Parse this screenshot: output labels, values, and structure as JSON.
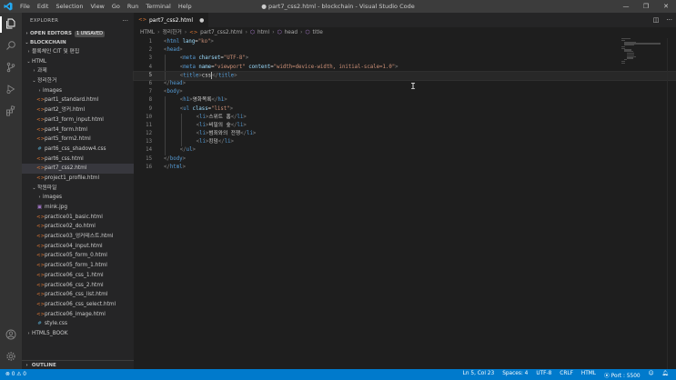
{
  "titlebar": {
    "menu": [
      "File",
      "Edit",
      "Selection",
      "View",
      "Go",
      "Run",
      "Terminal",
      "Help"
    ],
    "title": "● part7_css2.html - blockchain - Visual Studio Code"
  },
  "sidebar": {
    "header": "EXPLORER",
    "open_editors": "OPEN EDITORS",
    "unsaved_badge": "1 UNSAVED",
    "workspace": "BLOCKCHAIN",
    "items": [
      {
        "label": "블록체인 CIT 및 편집",
        "indent": 0,
        "kind": "folder-closed"
      },
      {
        "label": "HTML",
        "indent": 0,
        "kind": "folder-open"
      },
      {
        "label": "과제",
        "indent": 1,
        "kind": "folder-closed"
      },
      {
        "label": "정리한거",
        "indent": 1,
        "kind": "folder-open"
      },
      {
        "label": "images",
        "indent": 2,
        "kind": "folder-closed"
      },
      {
        "label": "part1_standard.html",
        "indent": 2,
        "kind": "html"
      },
      {
        "label": "part2_엉커.html",
        "indent": 2,
        "kind": "html"
      },
      {
        "label": "part3_form_input.html",
        "indent": 2,
        "kind": "html"
      },
      {
        "label": "part4_form.html",
        "indent": 2,
        "kind": "html"
      },
      {
        "label": "part5_form2.html",
        "indent": 2,
        "kind": "html"
      },
      {
        "label": "part6_css_shadow4.css",
        "indent": 2,
        "kind": "css"
      },
      {
        "label": "part6_css.html",
        "indent": 2,
        "kind": "html"
      },
      {
        "label": "part7_css2.html",
        "indent": 2,
        "kind": "html",
        "selected": true
      },
      {
        "label": "project1_profile.html",
        "indent": 2,
        "kind": "html"
      },
      {
        "label": "학원파일",
        "indent": 1,
        "kind": "folder-open"
      },
      {
        "label": "images",
        "indent": 2,
        "kind": "folder-closed"
      },
      {
        "label": "mink.jpg",
        "indent": 2,
        "kind": "jpg"
      },
      {
        "label": "practice01_basic.html",
        "indent": 2,
        "kind": "html"
      },
      {
        "label": "practice02_do.html",
        "indent": 2,
        "kind": "html"
      },
      {
        "label": "practice03_엉커테스트.html",
        "indent": 2,
        "kind": "html"
      },
      {
        "label": "practice04_input.html",
        "indent": 2,
        "kind": "html"
      },
      {
        "label": "practice05_form_0.html",
        "indent": 2,
        "kind": "html"
      },
      {
        "label": "practice05_form_1.html",
        "indent": 2,
        "kind": "html"
      },
      {
        "label": "practice06_css_1.html",
        "indent": 2,
        "kind": "html"
      },
      {
        "label": "practice06_css_2.html",
        "indent": 2,
        "kind": "html"
      },
      {
        "label": "practice06_css_list.html",
        "indent": 2,
        "kind": "html"
      },
      {
        "label": "practice06_css_select.html",
        "indent": 2,
        "kind": "html"
      },
      {
        "label": "practice06_image.html",
        "indent": 2,
        "kind": "html"
      },
      {
        "label": "style.css",
        "indent": 2,
        "kind": "css"
      },
      {
        "label": "HTML5_BOOK",
        "indent": 0,
        "kind": "folder-closed"
      }
    ],
    "outline": "OUTLINE"
  },
  "editor": {
    "tab_label": "part7_css2.html",
    "breadcrumbs": [
      "HTML",
      "정리한거",
      "part7_css2.html",
      "html",
      "head",
      "title"
    ],
    "current_line": 5,
    "lines": [
      {
        "n": "1",
        "indent": 0,
        "tokens": [
          [
            "b",
            "<"
          ],
          [
            "tag",
            "html"
          ],
          [
            "txt",
            " "
          ],
          [
            "attr",
            "lang"
          ],
          [
            "txt",
            "="
          ],
          [
            "str",
            "\"ko\""
          ],
          [
            "b",
            ">"
          ]
        ]
      },
      {
        "n": "2",
        "indent": 0,
        "tokens": [
          [
            "b",
            "<"
          ],
          [
            "tag",
            "head"
          ],
          [
            "b",
            ">"
          ]
        ]
      },
      {
        "n": "3",
        "indent": 2,
        "tokens": [
          [
            "b",
            "<"
          ],
          [
            "tag",
            "meta"
          ],
          [
            "txt",
            " "
          ],
          [
            "attr",
            "charset"
          ],
          [
            "txt",
            "="
          ],
          [
            "str",
            "\"UTF-8\""
          ],
          [
            "b",
            ">"
          ]
        ]
      },
      {
        "n": "4",
        "indent": 2,
        "tokens": [
          [
            "b",
            "<"
          ],
          [
            "tag",
            "meta"
          ],
          [
            "txt",
            " "
          ],
          [
            "attr",
            "name"
          ],
          [
            "txt",
            "="
          ],
          [
            "str",
            "\"viewport\""
          ],
          [
            "txt",
            " "
          ],
          [
            "attr",
            "content"
          ],
          [
            "txt",
            "="
          ],
          [
            "str",
            "\"width=device-width, initial-scale=1.0\""
          ],
          [
            "b",
            ">"
          ]
        ]
      },
      {
        "n": "5",
        "indent": 2,
        "tokens": [
          [
            "b",
            "<"
          ],
          [
            "tag",
            "title"
          ],
          [
            "b",
            ">"
          ],
          [
            "txt",
            "css"
          ],
          [
            "cursor",
            ""
          ],
          [
            "b",
            "</"
          ],
          [
            "tag",
            "title"
          ],
          [
            "b",
            ">"
          ]
        ]
      },
      {
        "n": "6",
        "indent": 0,
        "tokens": [
          [
            "b",
            "</"
          ],
          [
            "tag",
            "head"
          ],
          [
            "b",
            ">"
          ]
        ]
      },
      {
        "n": "7",
        "indent": 0,
        "tokens": [
          [
            "b",
            "<"
          ],
          [
            "tag",
            "body"
          ],
          [
            "b",
            ">"
          ]
        ]
      },
      {
        "n": "8",
        "indent": 2,
        "tokens": [
          [
            "b",
            "<"
          ],
          [
            "tag",
            "h1"
          ],
          [
            "b",
            ">"
          ],
          [
            "txt",
            "영화목록"
          ],
          [
            "b",
            "</"
          ],
          [
            "tag",
            "h1"
          ],
          [
            "b",
            ">"
          ]
        ]
      },
      {
        "n": "9",
        "indent": 2,
        "tokens": [
          [
            "b",
            "<"
          ],
          [
            "tag",
            "ul"
          ],
          [
            "txt",
            " "
          ],
          [
            "attr",
            "class"
          ],
          [
            "txt",
            "="
          ],
          [
            "str",
            "\"list\""
          ],
          [
            "b",
            ">"
          ]
        ]
      },
      {
        "n": "10",
        "indent": 4,
        "tokens": [
          [
            "b",
            "<"
          ],
          [
            "tag",
            "li"
          ],
          [
            "b",
            ">"
          ],
          [
            "txt",
            "스위트 홈"
          ],
          [
            "b",
            "</"
          ],
          [
            "tag",
            "li"
          ],
          [
            "b",
            ">"
          ]
        ]
      },
      {
        "n": "11",
        "indent": 4,
        "tokens": [
          [
            "b",
            "<"
          ],
          [
            "tag",
            "li"
          ],
          [
            "b",
            ">"
          ],
          [
            "txt",
            "비밀의 숲"
          ],
          [
            "b",
            "</"
          ],
          [
            "tag",
            "li"
          ],
          [
            "b",
            ">"
          ]
        ]
      },
      {
        "n": "12",
        "indent": 4,
        "tokens": [
          [
            "b",
            "<"
          ],
          [
            "tag",
            "li"
          ],
          [
            "b",
            ">"
          ],
          [
            "txt",
            "범죄와의 전쟁"
          ],
          [
            "b",
            "</"
          ],
          [
            "tag",
            "li"
          ],
          [
            "b",
            ">"
          ]
        ]
      },
      {
        "n": "13",
        "indent": 4,
        "tokens": [
          [
            "b",
            "<"
          ],
          [
            "tag",
            "li"
          ],
          [
            "b",
            ">"
          ],
          [
            "txt",
            "킹덤"
          ],
          [
            "b",
            "</"
          ],
          [
            "tag",
            "li"
          ],
          [
            "b",
            ">"
          ]
        ]
      },
      {
        "n": "14",
        "indent": 2,
        "tokens": [
          [
            "b",
            "</"
          ],
          [
            "tag",
            "ul"
          ],
          [
            "b",
            ">"
          ]
        ]
      },
      {
        "n": "15",
        "indent": 0,
        "tokens": [
          [
            "b",
            "</"
          ],
          [
            "tag",
            "body"
          ],
          [
            "b",
            ">"
          ]
        ]
      },
      {
        "n": "16",
        "indent": 0,
        "tokens": [
          [
            "b",
            "</"
          ],
          [
            "tag",
            "html"
          ],
          [
            "b",
            ">"
          ]
        ]
      }
    ]
  },
  "statusbar": {
    "errors": "0",
    "warnings": "0",
    "position": "Ln 5, Col 23",
    "spaces": "Spaces: 4",
    "encoding": "UTF-8",
    "eol": "CRLF",
    "language": "HTML",
    "port": "Port : 5500"
  },
  "colors": {
    "accent": "#007acc",
    "titlebar": "#3c3c3c",
    "sidebar": "#252526",
    "editor": "#1e1e1e",
    "tag": "#569cd6",
    "attr": "#9cdcfe",
    "string": "#ce9178"
  }
}
